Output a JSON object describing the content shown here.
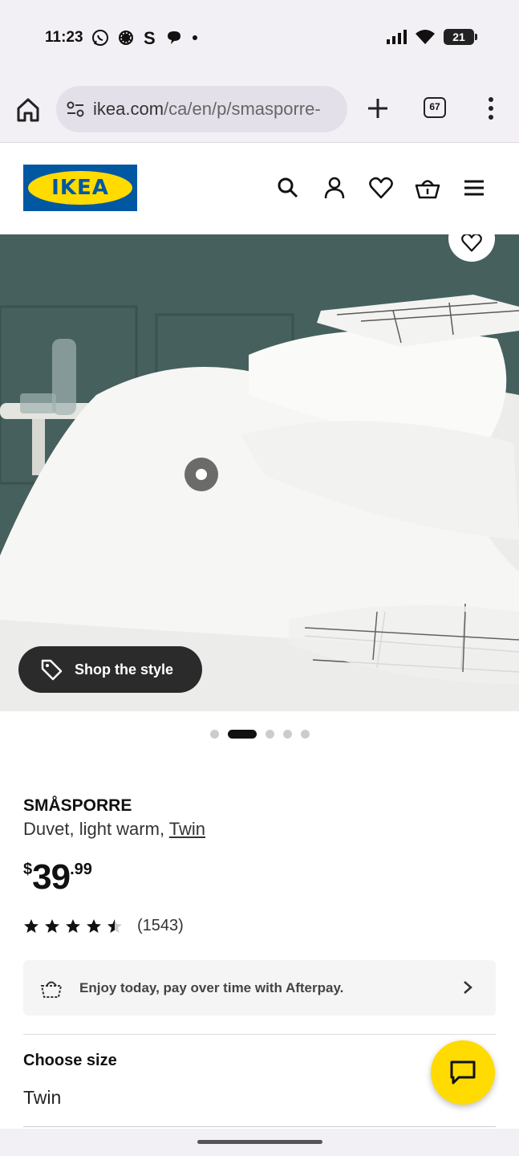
{
  "status_bar": {
    "time": "11:23",
    "battery": "21"
  },
  "browser": {
    "url_domain": "ikea.com",
    "url_path": "/ca/en/p/smasporre-",
    "tab_count": "67"
  },
  "header": {
    "logo_text": "IKEA"
  },
  "hero": {
    "shop_style_label": "Shop the style",
    "dot_count": 5,
    "active_dot": 1
  },
  "product": {
    "name": "SMÅSPORRE",
    "description": "Duvet, light warm, ",
    "size_link": "Twin",
    "price_currency": "$",
    "price_int": "39",
    "price_dec": ".99",
    "rating_value": 4.5,
    "rating_count": "(1543)"
  },
  "afterpay": {
    "text": "Enjoy today, pay over time with Afterpay."
  },
  "size": {
    "label": "Choose size",
    "value": "Twin"
  },
  "colors": {
    "ikea_blue": "#0058a3",
    "ikea_yellow": "#ffdb00"
  }
}
